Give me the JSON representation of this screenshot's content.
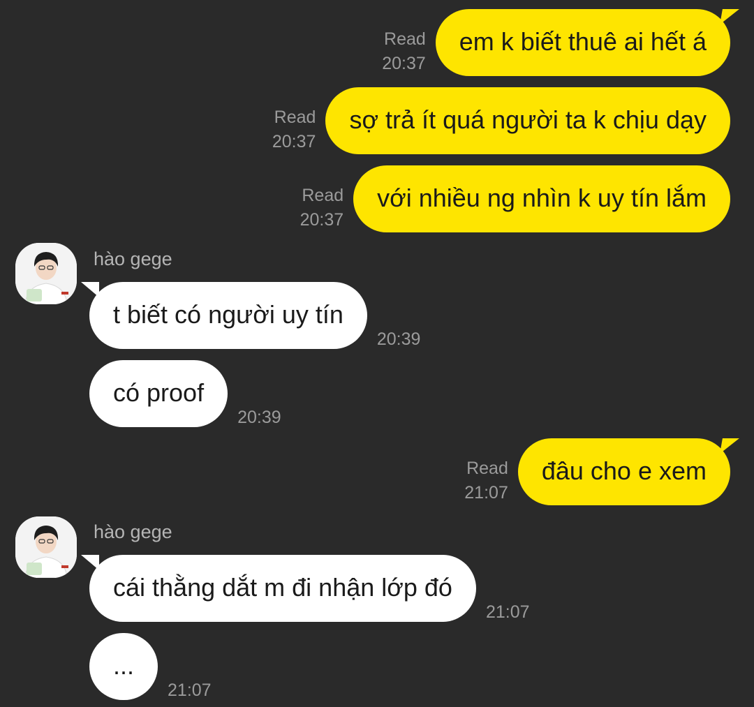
{
  "chat": {
    "messages": [
      {
        "dir": "out",
        "text": "em k biết thuê ai hết á",
        "status": "Read",
        "time": "20:37"
      },
      {
        "dir": "out",
        "text": "sợ trả ít quá người ta k chịu dạy",
        "status": "Read",
        "time": "20:37"
      },
      {
        "dir": "out",
        "text": "với nhiều ng nhìn k uy tín lắm",
        "status": "Read",
        "time": "20:37"
      },
      {
        "dir": "in",
        "sender": "hào gege",
        "text": "t biết có người uy tín",
        "time": "20:39"
      },
      {
        "dir": "in",
        "text": "có proof",
        "time": "20:39"
      },
      {
        "dir": "out",
        "text": "đâu cho e xem",
        "status": "Read",
        "time": "21:07"
      },
      {
        "dir": "in",
        "sender": "hào gege",
        "text": "cái thằng dắt m đi nhận lớp đó",
        "time": "21:07"
      },
      {
        "dir": "in",
        "text": "...",
        "time": "21:07"
      }
    ]
  },
  "colors": {
    "background": "#2a2a2a",
    "outgoing_bubble": "#fee500",
    "incoming_bubble": "#ffffff",
    "meta_text": "#9b9b9b"
  }
}
